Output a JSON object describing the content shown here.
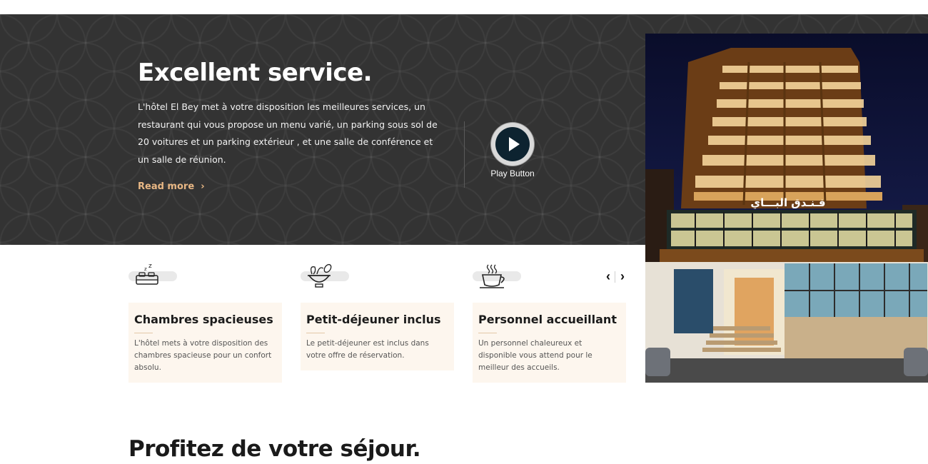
{
  "hero": {
    "title": "Excellent service.",
    "description": "L'hôtel El Bey met à votre disposition les meilleures services, un restaurant qui vous propose un menu varié, un parking sous sol de 20 voitures et un parking extérieur , et une salle de conférence et un salle de réunion.",
    "read_more_label": "Read more",
    "read_more_icon": "chevron-right-icon",
    "play_label": "Play Button",
    "accent_color": "#e8b784",
    "background_color": "#333333"
  },
  "photo": {
    "sign_text": "فـنـدق البـــاي",
    "subject": "hotel building at night"
  },
  "features": [
    {
      "icon": "sleeping-bed-icon",
      "title": "Chambres spacieuses",
      "text": "L'hôtel mets à votre disposition des chambres spacieuse pour un confort absolu."
    },
    {
      "icon": "breakfast-bowl-icon",
      "title": "Petit-déjeuner inclus",
      "text": "Le petit-déjeuner est inclus dans votre offre de réservation."
    },
    {
      "icon": "coffee-cup-icon",
      "title": "Personnel accueillant",
      "text": "Un personnel chaleureux et disponible vous attend pour le meilleur des accueils."
    }
  ],
  "carousel": {
    "prev": "‹",
    "next": "›"
  },
  "section": {
    "title": "Profitez de votre séjour."
  }
}
